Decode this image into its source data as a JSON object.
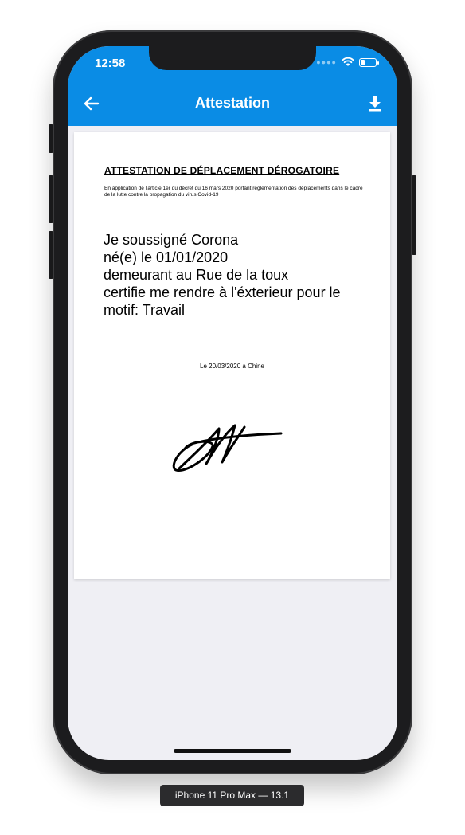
{
  "status_bar": {
    "time": "12:58",
    "battery_level": 0.25
  },
  "app_bar": {
    "title": "Attestation",
    "back_icon": "arrow-left-icon",
    "download_icon": "download-icon"
  },
  "document": {
    "title": "ATTESTATION DE DÉPLACEMENT DÉROGATOIRE",
    "subtitle": "En application de l'article 1er du décret du 16 mars 2020 portant réglementation des déplacements dans le cadre de la lutte contre la propagation du virus Covid-19",
    "body_lines": [
      "Je soussigné Corona",
      "né(e) le 01/01/2020",
      "demeurant au Rue de la toux",
      "certifie me rendre à l'éxterieur pour le",
      "motif: Travail"
    ],
    "date_place": "Le 20/03/2020 a Chine"
  },
  "device_label": "iPhone 11 Pro Max — 13.1",
  "colors": {
    "app_bar": "#0a8ce5",
    "screen_bg": "#efeff4"
  }
}
